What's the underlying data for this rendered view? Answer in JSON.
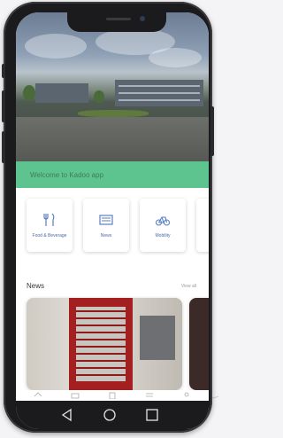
{
  "screen": {
    "welcome_text": "Welcome to Kadoo app",
    "quick_links": [
      {
        "label": "Food & Beverage",
        "icon": "fork-knife-icon"
      },
      {
        "label": "News",
        "icon": "newspaper-icon"
      },
      {
        "label": "Mobility",
        "icon": "bicycle-icon"
      }
    ],
    "news": {
      "heading": "News",
      "view_all": "View all"
    },
    "tab_icons": [
      "home-icon",
      "news-icon",
      "document-icon",
      "list-icon",
      "profile-icon"
    ],
    "nav_icons": [
      "back-icon",
      "home-circle-icon",
      "recents-icon"
    ]
  },
  "colors": {
    "welcome_bar": "#5ec48f",
    "link_text": "#4a6aa8",
    "phone_frame": "#1b1b1d"
  }
}
